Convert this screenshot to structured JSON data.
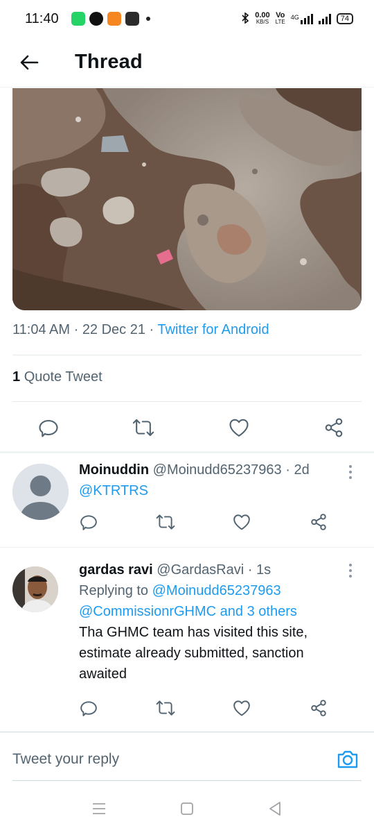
{
  "status_bar": {
    "time": "11:40",
    "net_speed": "0.00",
    "net_unit": "KB/S",
    "volte_top": "Vo",
    "volte_bottom": "LTE",
    "network": "4G",
    "battery": "74"
  },
  "header": {
    "title": "Thread"
  },
  "tweet": {
    "time": "11:04 AM",
    "date": "22 Dec 21",
    "source": "Twitter for Android",
    "quote_count": "1",
    "quote_label": "Quote Tweet"
  },
  "replies": [
    {
      "name": "Moinuddin",
      "handle": "@Moinudd65237963",
      "age": "2d",
      "text": "@KTRTRS"
    },
    {
      "name": "gardas ravi",
      "handle": "@GardasRavi",
      "age": "1s",
      "replying_prefix": "Replying to",
      "replying_first": "@Moinudd65237963",
      "replying_second": "@CommissionrGHMC",
      "replying_others": "and 3 others",
      "text": "Tha GHMC team has visited this site, estimate already submitted, sanction awaited"
    }
  ],
  "compose": {
    "placeholder": "Tweet your reply"
  },
  "colors": {
    "accent": "#1d9bf0",
    "secondary_text": "#536471",
    "primary_text": "#0f1419"
  }
}
